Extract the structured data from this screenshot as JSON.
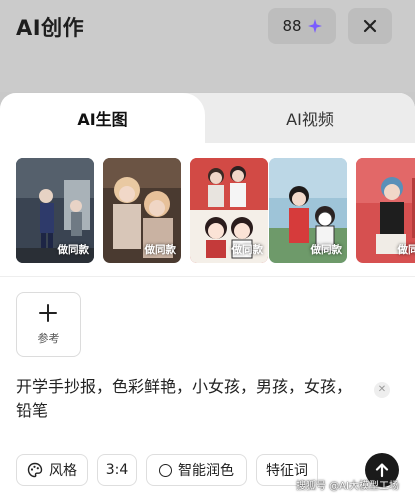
{
  "header": {
    "title": "AI创作",
    "credits": "88",
    "credits_icon": "sparkle-icon",
    "close_icon": "close-icon"
  },
  "tabs": [
    {
      "label": "AI生图",
      "active": true
    },
    {
      "label": "AI视频",
      "active": false
    }
  ],
  "templates": [
    {
      "badge": "做同款"
    },
    {
      "badge": "做同款"
    },
    {
      "badge": "做同款"
    },
    {
      "badge": "做同款"
    },
    {
      "badge": "做同款"
    }
  ],
  "reference": {
    "label": "参考",
    "icon": "plus-icon"
  },
  "prompt": {
    "text": "开学手抄报，色彩鲜艳，小女孩，男孩，女孩，铅笔"
  },
  "toolbar": {
    "style_label": "风格",
    "ratio_label": "3:4",
    "smart_label": "智能润色",
    "feature_label": "特征词"
  },
  "watermark": "搜狐号 @AI大模型工场",
  "colors": {
    "accent": "#7a5cff",
    "send_bg": "#1a1a1a"
  }
}
